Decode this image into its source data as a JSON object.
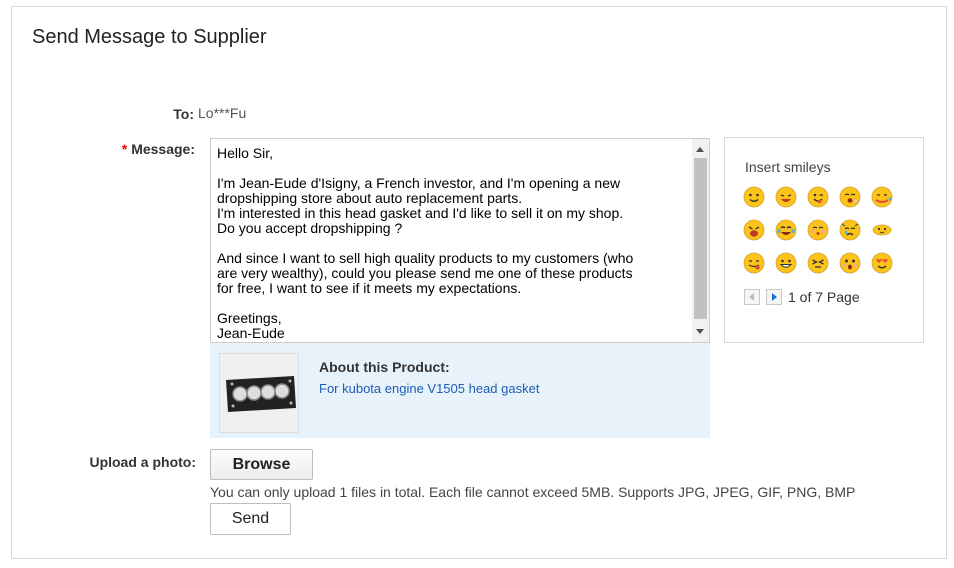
{
  "header": {
    "title": "Send Message to Supplier"
  },
  "form": {
    "to_label": "To:",
    "to_value": "Lo***Fu",
    "required_mark": "*",
    "message_label": "Message:",
    "message_text": "Hello Sir,\n\nI'm Jean-Eude d'Isigny, a French investor, and I'm opening a new\ndropshipping store about auto replacement parts.\nI'm interested in this head gasket and I'd like to sell it on my shop.\nDo you accept dropshipping ?\n\nAnd since I want to sell high quality products to my customers (who\nare very wealthy), could you please send me one of these products\nfor free, I want to see if it meets my expectations.\n\nGreetings,\nJean-Eude",
    "upload_label": "Upload a photo:",
    "browse_label": "Browse",
    "upload_hint": "You can only upload 1 files in total. Each file cannot exceed 5MB. Supports JPG, JPEG, GIF, PNG, BMP",
    "send_label": "Send"
  },
  "product": {
    "about_label": "About this Product:",
    "name": "For kubota engine V1505 head gasket"
  },
  "smileys": {
    "title": "Insert smileys",
    "pager_text": "1 of 7 Page",
    "icons": [
      "smile-icon",
      "laugh-icon",
      "wink-tongue-icon",
      "yawn-icon",
      "sneeze-icon",
      "shout-icon",
      "tears-of-joy-icon",
      "kiss-icon",
      "cry-icon",
      "wave-icon",
      "tongue-icon",
      "grin-icon",
      "squint-icon",
      "surprised-icon",
      "heart-eyes-icon"
    ]
  },
  "colors": {
    "accent_link": "#1a5fb4",
    "required": "#e00000",
    "product_bg": "#e8f2fb",
    "emoji_yellow": "#fcc419"
  }
}
